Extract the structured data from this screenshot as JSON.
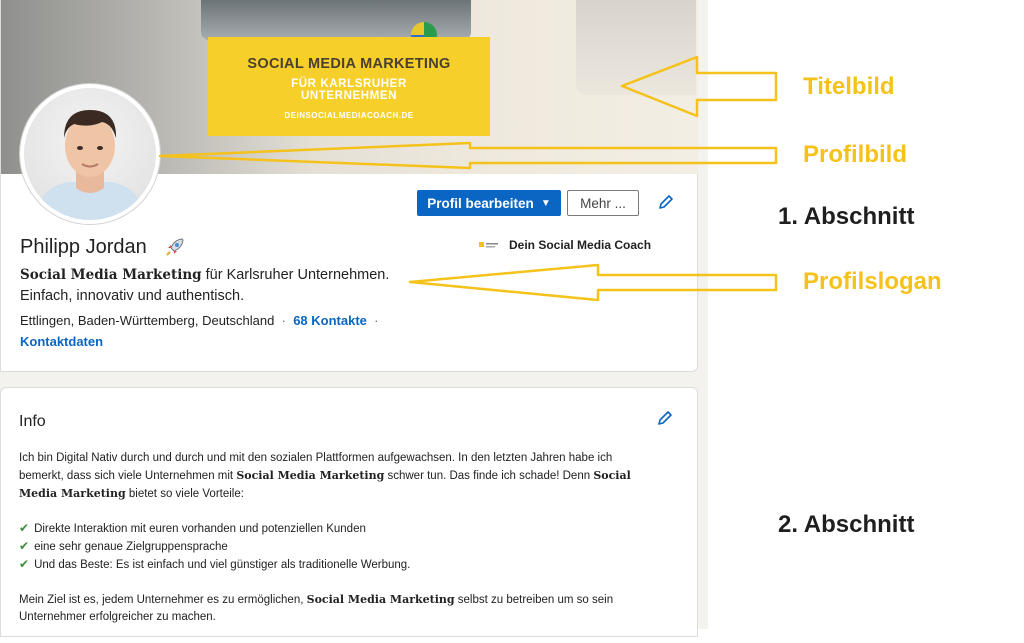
{
  "banner": {
    "title": "SOCIAL MEDIA MARKETING",
    "subtitle_line1": "FÜR KARLSRUHER",
    "subtitle_line2": "UNTERNEHMEN",
    "url": "DEINSOCIALMEDIACOACH.DE"
  },
  "profile": {
    "name": "Philipp Jordan",
    "slogan_bold": "Social Media Marketing",
    "slogan_rest": " für Karlsruher Unternehmen.",
    "slogan_line2": "Einfach, innovativ und authentisch.",
    "location": "Ettlingen, Baden-Württemberg, Deutschland",
    "separator": "·",
    "contacts": "68 Kontakte",
    "contact_info": "Kontaktdaten",
    "company": "Dein Social Media Coach"
  },
  "actions": {
    "edit_profile": "Profil bearbeiten",
    "more": "Mehr ..."
  },
  "info": {
    "heading": "Info",
    "p1_a": "Ich bin Digital Nativ durch und durch und mit den sozialen Plattformen aufgewachsen. In den letzten Jahren habe ich bemerkt, dass sich viele Unternehmen mit ",
    "p1_b": "Social Media Marketing",
    "p1_c": " schwer tun. Das finde ich schade! Denn ",
    "p1_d": "Social Media Marketing",
    "p1_e": " bietet so viele Vorteile:",
    "bullets": [
      "Direkte Interaktion mit euren vorhanden und potenziellen Kunden",
      "eine sehr genaue Zielgruppensprache",
      "Und das Beste: Es ist einfach und viel günstiger als traditionelle Werbung."
    ],
    "p2_a": "Mein Ziel ist es, jedem Unternehmer es zu ermöglichen, ",
    "p2_b": "Social Media Marketing",
    "p2_c": " selbst zu betreiben um so sein Unternehmer erfolgreicher zu machen."
  },
  "annotations": {
    "titelbild": "Titelbild",
    "profilbild": "Profilbild",
    "profilslogan": "Profilslogan",
    "section1": "1. Abschnitt",
    "section2": "2. Abschnitt",
    "color": "#f4c21b"
  }
}
